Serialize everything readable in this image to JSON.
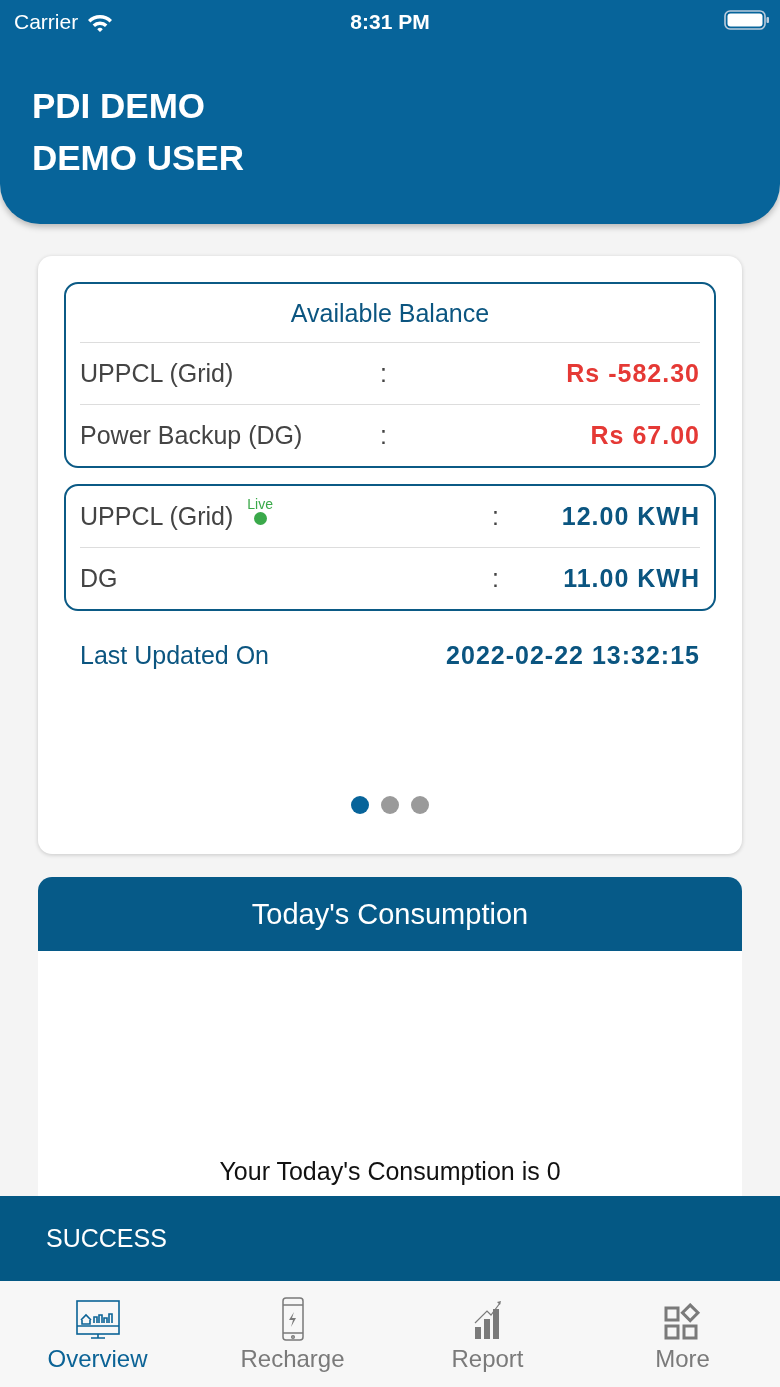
{
  "status_bar": {
    "carrier": "Carrier",
    "time": "8:31 PM"
  },
  "header": {
    "title": "PDI DEMO",
    "user": "DEMO USER"
  },
  "balance_card": {
    "title": "Available Balance",
    "rows": [
      {
        "label": "UPPCL (Grid)",
        "separator": ":",
        "value": "Rs -582.30"
      },
      {
        "label": "Power Backup (DG)",
        "separator": ":",
        "value": "Rs 67.00"
      }
    ]
  },
  "meter_card": {
    "rows": [
      {
        "label": "UPPCL (Grid)",
        "badge": "Live",
        "separator": ":",
        "value": "12.00 KWH"
      },
      {
        "label": "DG",
        "separator": ":",
        "value": "11.00 KWH"
      }
    ]
  },
  "last_updated": {
    "label": "Last Updated On",
    "value": "2022-02-22 13:32:15"
  },
  "pager": [
    {
      "selected": true
    },
    {
      "selected": false
    },
    {
      "selected": false
    }
  ],
  "consumption": {
    "title": "Today's Consumption",
    "message": "Your Today's Consumption is 0"
  },
  "snackbar": {
    "text": "SUCCESS"
  },
  "tabs": [
    {
      "kind": "overview",
      "label": "Overview",
      "selected": true
    },
    {
      "kind": "recharge",
      "label": "Recharge",
      "selected": false
    },
    {
      "kind": "report",
      "label": "Report",
      "selected": false
    },
    {
      "kind": "more",
      "label": "More",
      "selected": false
    }
  ]
}
